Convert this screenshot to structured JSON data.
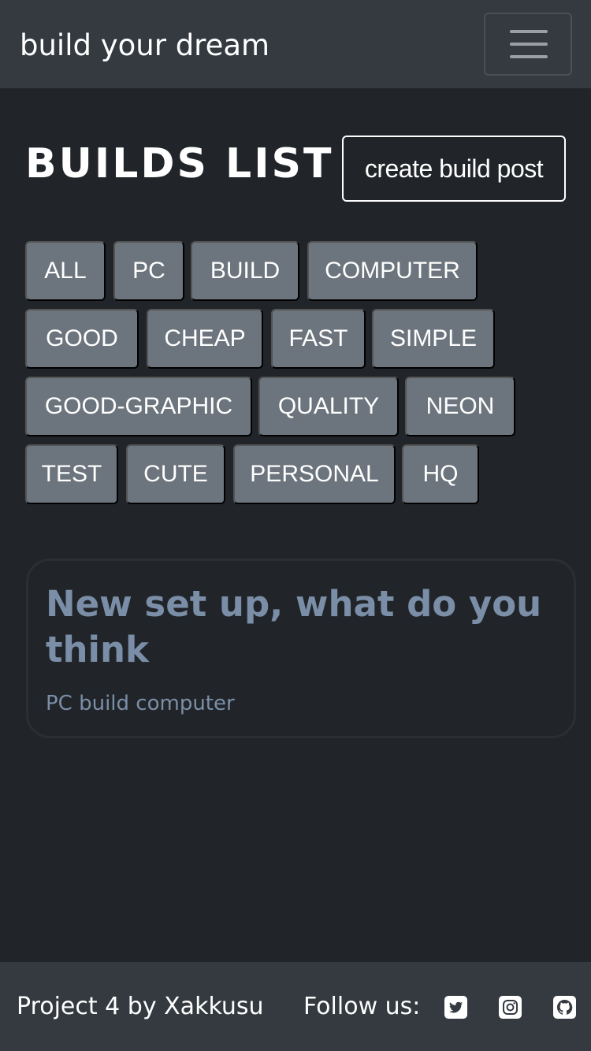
{
  "navbar": {
    "brand": "build your dream",
    "menu_icon": "hamburger-menu-icon"
  },
  "main": {
    "title": "BUILDS LIST",
    "create_button_label": "create build post",
    "tags": [
      "ALL",
      "PC",
      "BUILD",
      "COMPUTER",
      "GOOD",
      "CHEAP",
      "FAST",
      "SIMPLE",
      "GOOD-GRAPHIC",
      "QUALITY",
      "NEON",
      "TEST",
      "CUTE",
      "PERSONAL",
      "HQ"
    ]
  },
  "posts": [
    {
      "title": "New set up, what do you think",
      "tags": "PC build computer"
    }
  ],
  "footer": {
    "credit": "Project 4 by Xakkusu",
    "follow_label": "Follow us:",
    "social_icons": [
      "twitter-icon",
      "instagram-icon",
      "github-icon"
    ]
  },
  "colors": {
    "page_bg": "#212529",
    "navbar_bg": "#343a40",
    "tag_bg": "#6c757d",
    "card_text": "#7b8ea7"
  }
}
